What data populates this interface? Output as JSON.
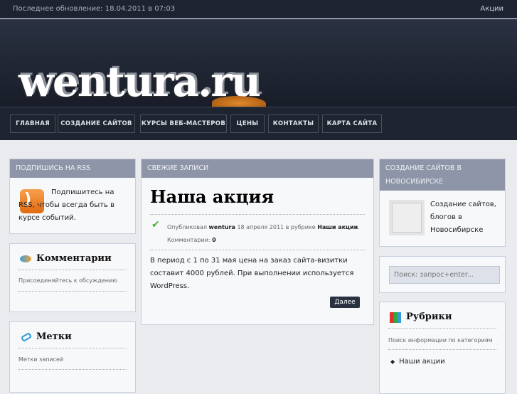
{
  "topbar": {
    "last_update": "Последнее обновление: 18.04.2011 в 07:03",
    "link": "Акции"
  },
  "logo": {
    "text": "wentura.ru"
  },
  "nav": [
    "ГЛАВНАЯ",
    "СОЗДАНИЕ САЙТОВ",
    "КУРСЫ ВЕБ-МАСТЕРОВ",
    "ЦЕНЫ",
    "КОНТАКТЫ",
    "КАРТА САЙТА"
  ],
  "rss": {
    "title": "ПОДПИШИСЬ НА RSS",
    "text": "Подпишитесь на RSS, чтобы всегда быть в курсе событий."
  },
  "comments": {
    "title": "Комментарии",
    "text": "Присоединяйтесь к обсуждению"
  },
  "tags": {
    "title": "Метки",
    "text": "Метки записей"
  },
  "posts": {
    "header": "СВЕЖИЕ ЗАПИСИ",
    "title": "Наша акция",
    "meta_prefix": "Опубликовал",
    "author": "wentura",
    "meta_mid": "18 апреля 2011 в рубрике",
    "category": "Наши акции",
    "comments_label": "Комментарии:",
    "comments_count": "0",
    "body": "В период с 1 по 31 мая цена на заказ сайта-визитки составит 4000 рублей. При выполнении используется WordPress.",
    "more": "Далее"
  },
  "promo": {
    "title": "СОЗДАНИЕ САЙТОВ В НОВОСИБИРСКЕ",
    "text": "Создание сайтов, блогов в Новосибирске"
  },
  "search": {
    "placeholder": "Поиск: запрос+enter..."
  },
  "rubrics": {
    "title": "Рубрики",
    "text": "Поиск информации по категориям",
    "items": [
      "Наши акции"
    ]
  }
}
